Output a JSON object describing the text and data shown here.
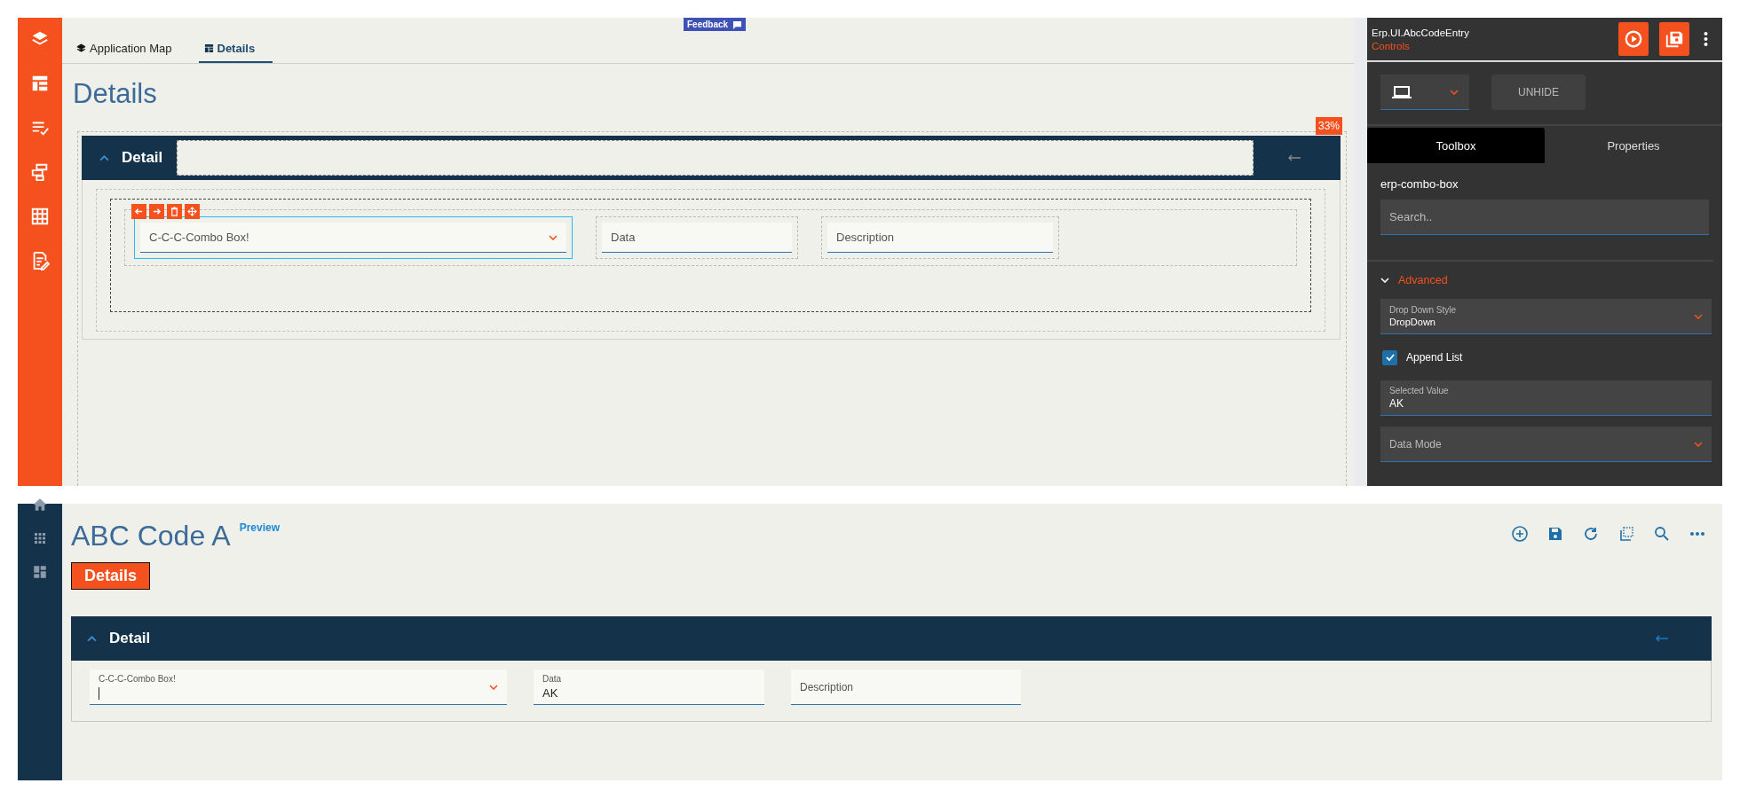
{
  "designer": {
    "tabs": [
      {
        "label": "Application Map",
        "selected": false
      },
      {
        "label": "Details",
        "selected": true
      }
    ],
    "feedback": "Feedback",
    "page_title": "Details",
    "zoom_badge": "33%",
    "panel": {
      "title": "Detail"
    },
    "fields": [
      {
        "kind": "combo",
        "label": "C-C-C-Combo Box!",
        "selected": true
      },
      {
        "kind": "text",
        "label": "Data",
        "selected": false
      },
      {
        "kind": "text",
        "label": "Description",
        "selected": false
      }
    ]
  },
  "inspector": {
    "title": "Erp.UI.AbcCodeEntry",
    "subtitle": "Controls",
    "unhide": "UNHIDE",
    "tabs": [
      {
        "label": "Toolbox",
        "selected": true
      },
      {
        "label": "Properties",
        "selected": false
      }
    ],
    "component": "erp-combo-box",
    "search": {
      "placeholder": "Search.."
    },
    "section": {
      "label": "Advanced",
      "expanded": true
    },
    "properties": [
      {
        "kind": "select",
        "label": "Drop Down Style",
        "value": "DropDown"
      },
      {
        "kind": "checkbox",
        "label": "Append List",
        "checked": true
      },
      {
        "kind": "text",
        "label": "Selected Value",
        "value": "AK"
      },
      {
        "kind": "select",
        "placeholder": "Data Mode"
      }
    ]
  },
  "preview": {
    "title": "ABC Code A",
    "badge": "Preview",
    "section_button": "Details",
    "panel": {
      "title": "Detail"
    },
    "fields": [
      {
        "kind": "combo",
        "label": "C-C-C-Combo Box!",
        "focused": true
      },
      {
        "kind": "text",
        "label": "Data",
        "value": "AK"
      },
      {
        "kind": "text",
        "placeholder": "Description"
      }
    ]
  }
}
